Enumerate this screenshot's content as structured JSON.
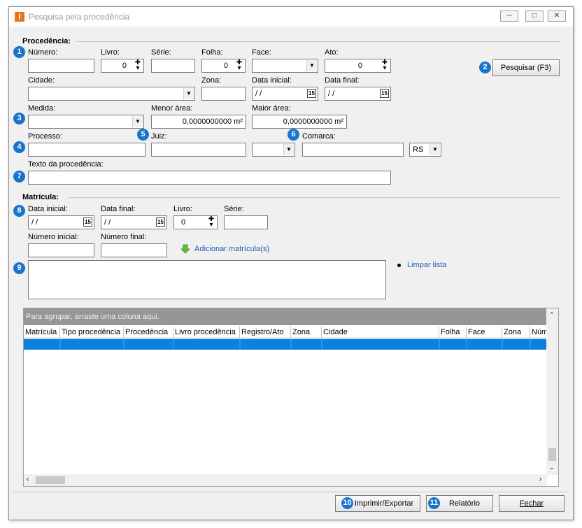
{
  "window": {
    "title": "Pesquisa pela procedência",
    "app_icon": "I",
    "minimize_icon": "minimize-icon",
    "maximize_icon": "maximize-icon",
    "close_icon": "close-icon"
  },
  "procedencia": {
    "section_title": "Procedência:",
    "numero": {
      "label": "Número:",
      "value": ""
    },
    "livro": {
      "label": "Livro:",
      "value": "0"
    },
    "serie": {
      "label": "Série:",
      "value": ""
    },
    "folha": {
      "label": "Folha:",
      "value": "0"
    },
    "face": {
      "label": "Face:",
      "value": ""
    },
    "ato": {
      "label": "Ato:",
      "value": "0"
    },
    "cidade": {
      "label": "Cidade:",
      "value": ""
    },
    "zona": {
      "label": "Zona:",
      "value": ""
    },
    "data_inicial": {
      "label": "Data inicial:",
      "value": " / /"
    },
    "data_final": {
      "label": "Data final:",
      "value": " / /"
    },
    "medida": {
      "label": "Medida:",
      "value": ""
    },
    "menor_area": {
      "label": "Menor área:",
      "value": "0,0000000000 m²"
    },
    "maior_area": {
      "label": "Maior área:",
      "value": "0,0000000000 m²"
    },
    "processo": {
      "label": "Processo:",
      "value": ""
    },
    "juiz": {
      "label": "Juiz:",
      "value": ""
    },
    "comarca": {
      "label": "Comarca:",
      "value": "",
      "uf": "RS"
    },
    "texto": {
      "label": "Texto da procedência:",
      "value": ""
    },
    "search_button": "Pesquisar (F3)"
  },
  "matricula": {
    "section_title": "Matrícula:",
    "data_inicial": {
      "label": "Data inicial:",
      "value": " / /"
    },
    "data_final": {
      "label": "Data final:",
      "value": " / /"
    },
    "livro": {
      "label": "Livro:",
      "value": "0"
    },
    "serie": {
      "label": "Série:",
      "value": ""
    },
    "numero_inicial": {
      "label": "Número inicial:",
      "value": ""
    },
    "numero_final": {
      "label": "Número final:",
      "value": ""
    },
    "add_link": "Adicionar matrícula(s)",
    "clear_link": "Limpar lista"
  },
  "grid": {
    "group_hint": "Para agrupar, arraste uma coluna aqui.",
    "columns": [
      "Matrícula",
      "Tipo procedência",
      "Procedência",
      "Livro procedência",
      "Registro/Ato",
      "Zona",
      "Cidade",
      "Folha",
      "Face",
      "Zona",
      "Núme"
    ]
  },
  "badges": [
    "1",
    "2",
    "3",
    "4",
    "5",
    "6",
    "7",
    "8",
    "9",
    "10",
    "11"
  ],
  "footer": {
    "print_export": "Imprimir/Exportar",
    "report": "Relatório",
    "close": "Fechar"
  },
  "colors": {
    "badge": "#1874cd",
    "selected_row": "#0b82e0",
    "group_header": "#969696",
    "app_icon": "#e8761a",
    "link": "#1a5fb4"
  }
}
